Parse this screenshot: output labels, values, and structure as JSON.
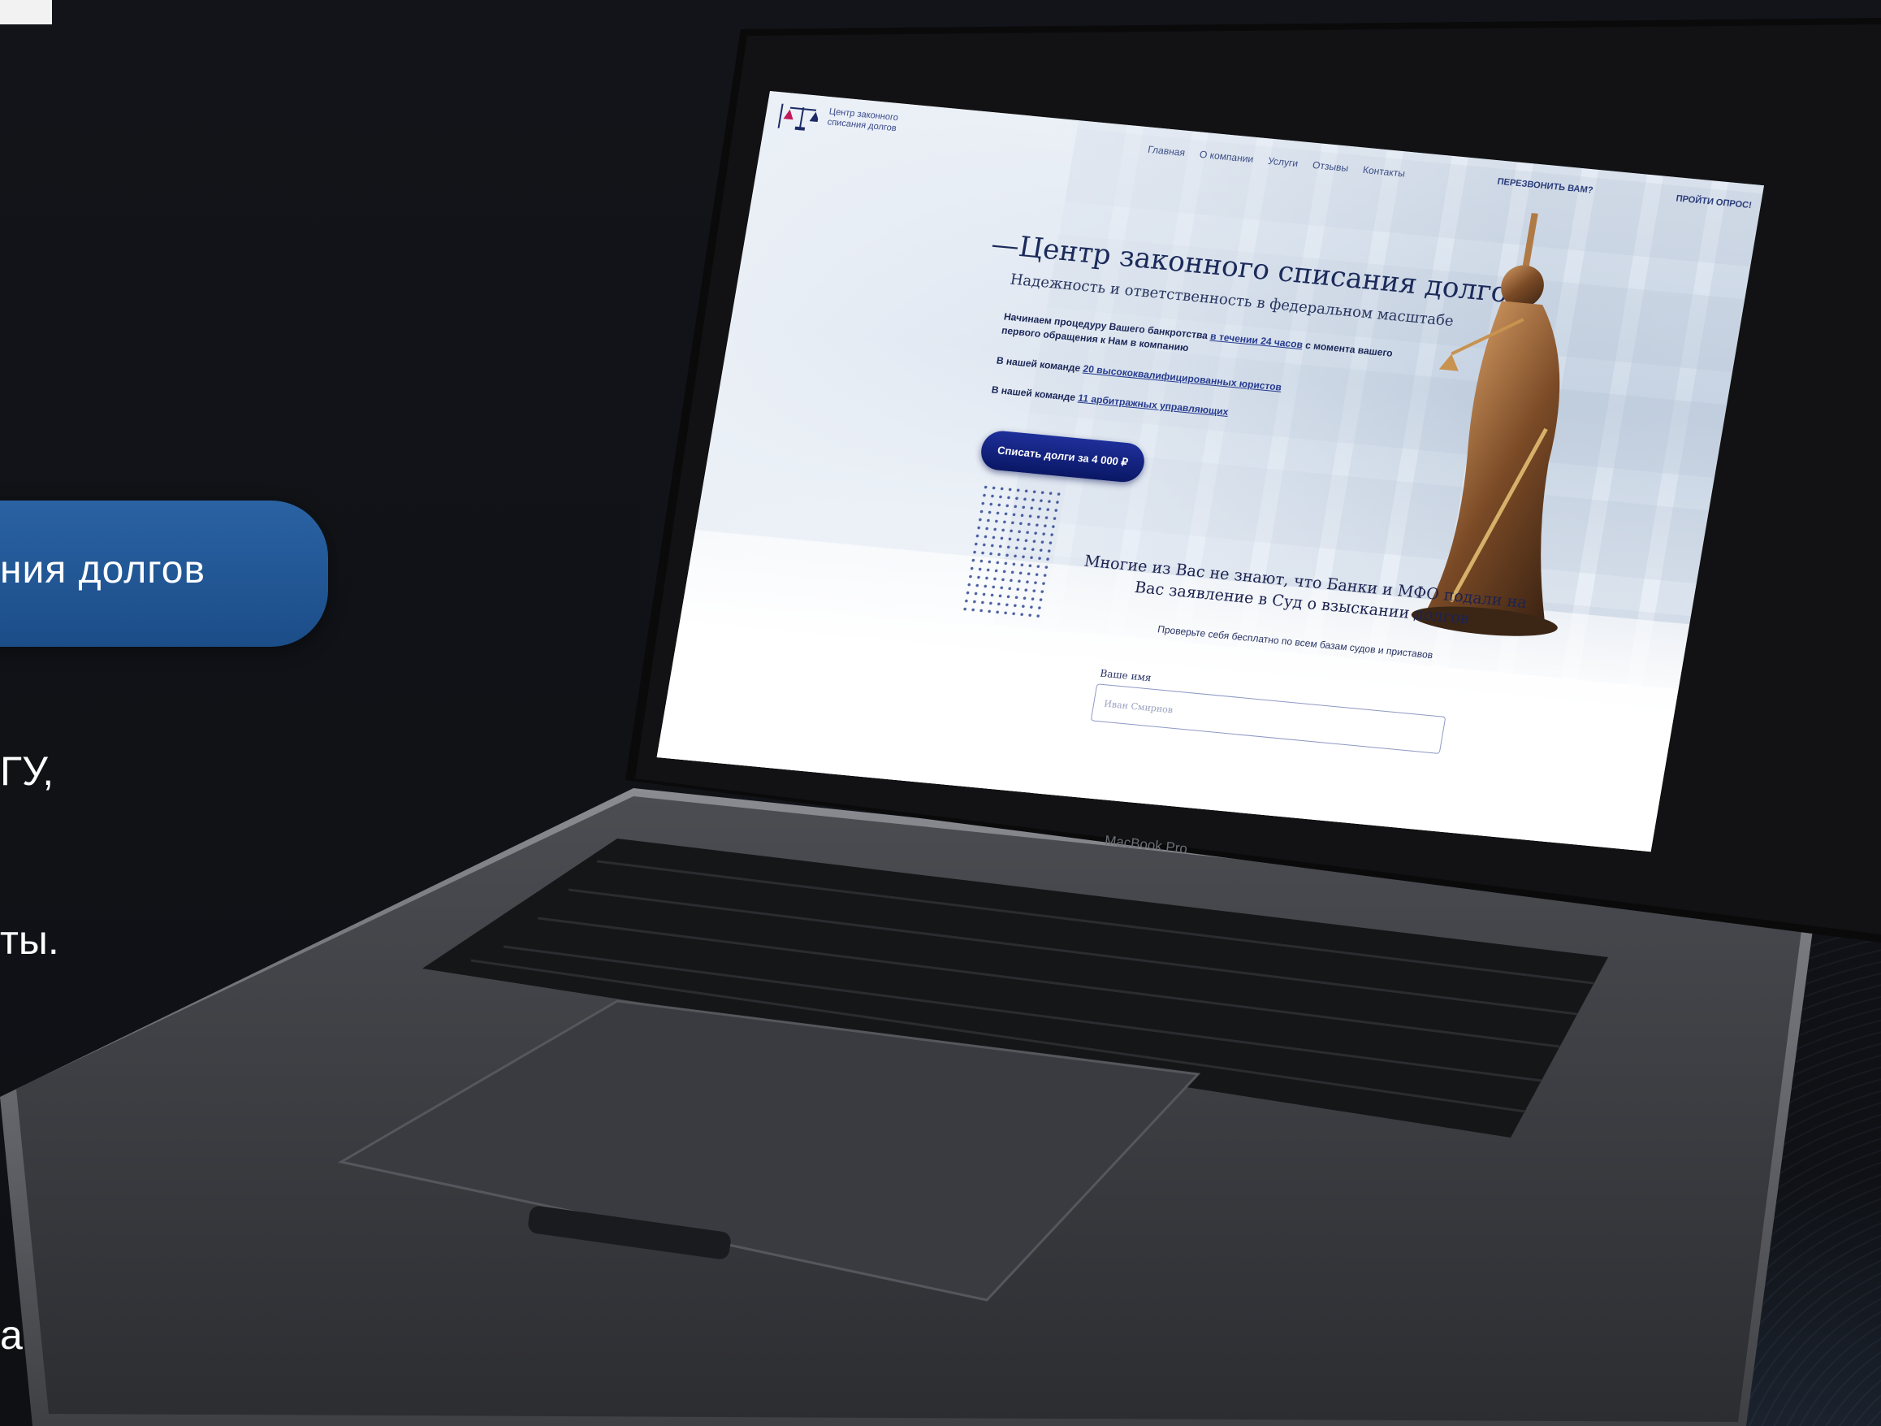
{
  "slide": {
    "pill_text": "ния долгов",
    "side_lines": [
      "ГУ,",
      "ты.",
      "а"
    ]
  },
  "laptop": {
    "model_label": "MacBook Pro"
  },
  "site": {
    "logo_text": "Центр законного списания долгов",
    "nav": [
      "Главная",
      "О компании",
      "Услуги",
      "Отзывы",
      "Контакты"
    ],
    "callback": "ПЕРЕЗВОНИТЬ ВАМ?",
    "survey": "ПРОЙТИ ОПРОС!",
    "hero": {
      "title": "—Центр законного списания долгов",
      "subtitle": "Надежность и ответственность в федеральном масштабе",
      "p1_before": "Начинаем процедуру Вашего банкротства ",
      "p1_link": "в течении 24 часов",
      "p1_after": " с момента вашего первого обращения к Нам в компанию",
      "p2_before": "В нашей команде ",
      "p2_link": "20 высококвалифицированных юристов",
      "p3_before": "В нашей команде ",
      "p3_link": "11 арбитражных управляющих",
      "button": "Списать долги за 4 000 ₽"
    },
    "lower": {
      "heading": "Многие из Вас не знают, что Банки и МФО подали на Вас заявление в Суд о взыскании долгов",
      "sub": "Проверьте себя бесплатно по всем базам судов и приставов",
      "name_label": "Ваше имя",
      "name_placeholder": "Иван Смирнов"
    }
  },
  "colors": {
    "pill": "#1f5595",
    "site_accent": "#0a1765",
    "bg": "#0f1115"
  }
}
